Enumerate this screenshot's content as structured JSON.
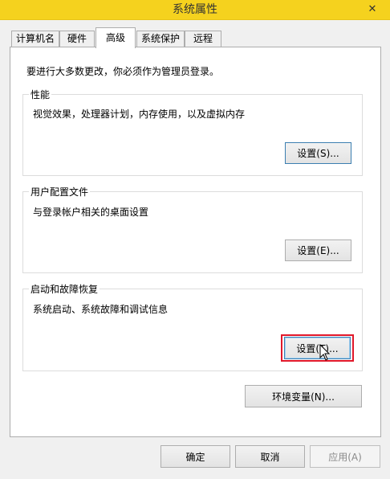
{
  "window": {
    "title": "系统属性",
    "close_glyph": "✕"
  },
  "tabs": [
    {
      "label": "计算机名"
    },
    {
      "label": "硬件"
    },
    {
      "label": "高级",
      "active": true
    },
    {
      "label": "系统保护"
    },
    {
      "label": "远程"
    }
  ],
  "admin_note": "要进行大多数更改，你必须作为管理员登录。",
  "performance": {
    "label": "性能",
    "description": "视觉效果，处理器计划，内存使用，以及虚拟内存",
    "button": "设置(S)..."
  },
  "user_profiles": {
    "label": "用户配置文件",
    "description": "与登录帐户相关的桌面设置",
    "button": "设置(E)..."
  },
  "startup_recovery": {
    "label": "启动和故障恢复",
    "description": "系统启动、系统故障和调试信息",
    "button": "设置(T)..."
  },
  "env_button": "环境变量(N)...",
  "footer": {
    "ok": "确定",
    "cancel": "取消",
    "apply": "应用(A)"
  },
  "colors": {
    "titlebar": "#f5d21e",
    "highlight": "#e0182a",
    "focus_border": "#3c7fb1"
  }
}
